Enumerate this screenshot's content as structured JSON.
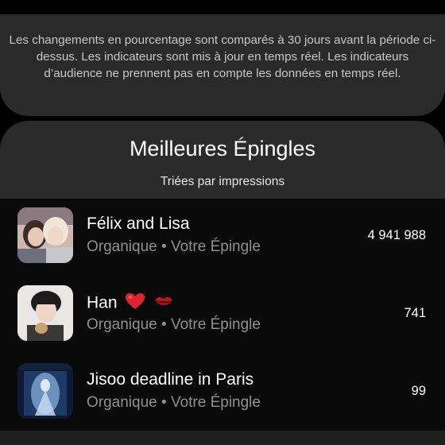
{
  "info": {
    "text": "Les changements en pourcentage sont comparés à 30 jours avant la période ci-dessus. Les indicateurs sont mis à jour en temps réel. Les indicateurs d’audience ne prennent pas en compte les données en temps réel."
  },
  "top_pins": {
    "title": "Meilleures Épingles",
    "subtitle": "Triées par impressions",
    "items": [
      {
        "title": "Félix and Lisa",
        "subtitle": "Organique • Votre Épingle",
        "value": "4 941 988"
      },
      {
        "title": "Han",
        "subtitle": "Organique • Votre Épingle",
        "value": "741",
        "emojis": [
          "red-heart-icon",
          "kiss-mark-icon"
        ]
      },
      {
        "title": "Jisoo deadline in Paris",
        "subtitle": "Organique • Votre Épingle",
        "value": "99"
      }
    ]
  },
  "colors": {
    "background": "#000000",
    "card": "#2a2a2a",
    "muted_text": "#8f8f8f",
    "heart": "#e0242f"
  }
}
